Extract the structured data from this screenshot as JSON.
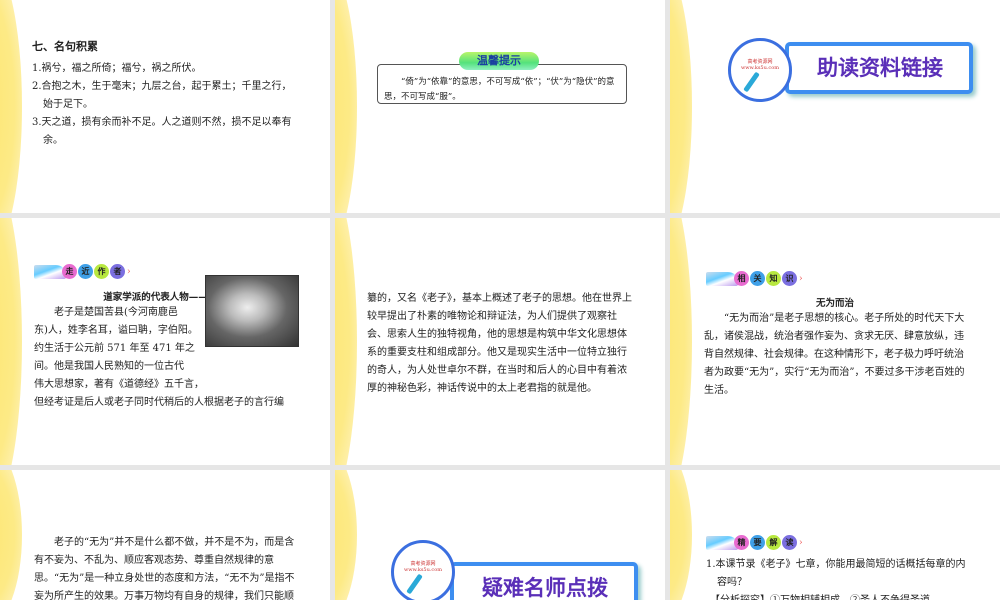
{
  "slide1": {
    "heading": "七、名句积累",
    "lines": [
      "1.祸兮，福之所倚；福兮，祸之所伏。",
      "2.合抱之木，生于毫末；九层之台，起于累土；千里之行，始于足下。",
      "3.天之道，损有余而补不足。人之道则不然，损不足以奉有余。"
    ]
  },
  "slide2": {
    "badge": "温馨提示",
    "text": "“倚”为“依靠”的意思，不可写成“依”；“伏”为“隐伏”的意思，不可写成“服”。"
  },
  "slide3": {
    "circle_line1": "高考资源网",
    "circle_line2": "www.ks5u.com",
    "title": "助读资料链接"
  },
  "slide4": {
    "section_chars": [
      "走",
      "近",
      "作",
      "者"
    ],
    "title": "道家学派的代表人物——老子",
    "lines": [
      "老子是楚国苦县(今河南鹿邑",
      "东)人，姓李名耳，谥曰聃，字伯阳。",
      "约生活于公元前 571 年至 471 年之",
      "间。他是我国人民熟知的一位古代",
      "伟大思想家，著有《道德经》五千言，",
      "但经考证是后人或老子同时代稍后的人根据老子的言行编"
    ]
  },
  "slide5": {
    "text": "纂的，又名《老子》，基本上概述了老子的思想。他在世界上较早提出了朴素的唯物论和辩证法，为人们提供了观察社会、思索人生的独特视角，他的思想是构筑中华文化思想体系的重要支柱和组成部分。他又是现实生活中一位特立独行的奇人，为人处世卓尔不群，在当时和后人的心目中有着浓厚的神秘色彩，神话传说中的太上老君指的就是他。"
  },
  "slide6": {
    "section_chars": [
      "相",
      "关",
      "知",
      "识"
    ],
    "title": "无为而治",
    "text": "“无为而治”是老子思想的核心。老子所处的时代天下大乱，诸侯混战，统治者强作妄为、贪求无厌、肆意放纵，违背自然规律、社会规律。在这种情形下，老子极力呼吁统治者为政要“无为”，实行“无为而治”，不要过多干涉老百姓的生活。"
  },
  "slide7": {
    "text": "老子的“无为”并不是什么都不做，并不是不为，而是含有不妄为、不乱为、顺应客观态势、尊重自然规律的意思。“无为”是一种立身处世的态度和方法，“无不为”是指不妄为所产生的效果。万事万物均有自身的规律，我们只能顺"
  },
  "slide8": {
    "circle_line1": "高考资源网",
    "circle_line2": "www.ks5u.com",
    "title": "疑难名师点拨"
  },
  "slide9": {
    "section_chars": [
      "精",
      "要",
      "解",
      "读"
    ],
    "question": "1.本课节录《老子》七章，你能用最简短的话概括每章的内容吗？",
    "analysis": "【分析探究】①万物相辅相成。②圣人不争得圣道"
  },
  "colors": {
    "dots": [
      "#e86bd0",
      "#3fa0e8",
      "#b8e840",
      "#7b6fe0"
    ]
  }
}
